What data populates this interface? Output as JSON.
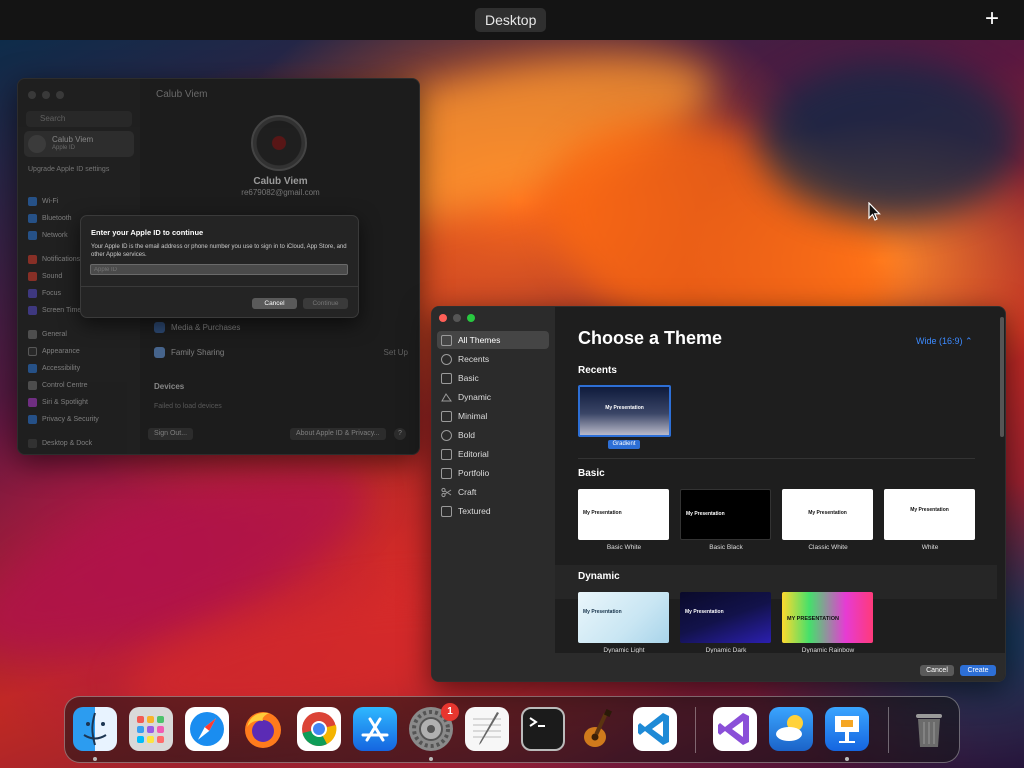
{
  "topbar": {
    "desktop_label": "Desktop",
    "add_label": "+"
  },
  "settings": {
    "window_title": "Calub Viem",
    "search_placeholder": "Search",
    "user": {
      "name": "Calub Viem",
      "subtitle": "Apple ID"
    },
    "promo": "Upgrade Apple ID settings",
    "sidebar_items": [
      "Wi-Fi",
      "Bluetooth",
      "Network",
      "Notifications",
      "Sound",
      "Focus",
      "Screen Time",
      "General",
      "Appearance",
      "Accessibility",
      "Control Centre",
      "Siri & Spotlight",
      "Privacy & Security",
      "Desktop & Dock"
    ],
    "account": {
      "name": "Calub Viem",
      "email": "re679082@gmail.com"
    },
    "rows": [
      {
        "label": "Media & Purchases",
        "right": ""
      },
      {
        "label": "Family Sharing",
        "right": "Set Up"
      }
    ],
    "devices_header": "Devices",
    "devices_note": "Failed to load devices",
    "sign_out": "Sign Out...",
    "about": "About Apple ID & Privacy...",
    "help": "?"
  },
  "dialog": {
    "title": "Enter your Apple ID to continue",
    "body": "Your Apple ID is the email address or phone number you use to sign in to iCloud, App Store, and other Apple services.",
    "input_placeholder": "Apple ID",
    "cancel": "Cancel",
    "continue": "Continue"
  },
  "keynote": {
    "sidebar": [
      {
        "label": "All Themes",
        "icon": "all-themes-icon",
        "selected": true
      },
      {
        "label": "Recents",
        "icon": "clock-icon"
      },
      {
        "label": "Basic",
        "icon": "basic-icon"
      },
      {
        "label": "Dynamic",
        "icon": "dynamic-icon"
      },
      {
        "label": "Minimal",
        "icon": "minimal-icon"
      },
      {
        "label": "Bold",
        "icon": "bold-icon"
      },
      {
        "label": "Editorial",
        "icon": "editorial-icon"
      },
      {
        "label": "Portfolio",
        "icon": "portfolio-icon"
      },
      {
        "label": "Craft",
        "icon": "scissors-icon"
      },
      {
        "label": "Textured",
        "icon": "textured-icon"
      }
    ],
    "title": "Choose a Theme",
    "aspect": "Wide (16:9) ⌃",
    "sections": {
      "recents": "Recents",
      "basic": "Basic",
      "dynamic": "Dynamic"
    },
    "recents_themes": [
      {
        "name": "Gradient",
        "thumb_title": "My Presentation"
      }
    ],
    "basic_themes": [
      {
        "name": "Basic White",
        "thumb_title": "My Presentation"
      },
      {
        "name": "Basic Black",
        "thumb_title": "My Presentation"
      },
      {
        "name": "Classic White",
        "thumb_title": "My Presentation"
      },
      {
        "name": "White",
        "thumb_title": "My Presentation"
      }
    ],
    "dynamic_themes": [
      {
        "name": "Dynamic Light",
        "thumb_title": "My Presentation"
      },
      {
        "name": "Dynamic Dark",
        "thumb_title": "My Presentation"
      },
      {
        "name": "Dynamic Rainbow",
        "thumb_title": "MY PRESENTATION"
      }
    ],
    "cancel": "Cancel",
    "create": "Create"
  },
  "dock": {
    "apps": [
      {
        "name": "Finder",
        "icon": "finder-icon",
        "running": true
      },
      {
        "name": "Launchpad",
        "icon": "launchpad-icon"
      },
      {
        "name": "Safari",
        "icon": "safari-icon"
      },
      {
        "name": "Firefox",
        "icon": "firefox-icon"
      },
      {
        "name": "Chrome",
        "icon": "chrome-icon"
      },
      {
        "name": "App Store",
        "icon": "app-store-icon"
      },
      {
        "name": "System Settings",
        "icon": "settings-icon",
        "running": true,
        "badge": "1"
      },
      {
        "name": "TextEdit",
        "icon": "textedit-icon"
      },
      {
        "name": "Terminal",
        "icon": "terminal-icon"
      },
      {
        "name": "GarageBand",
        "icon": "garageband-icon"
      },
      {
        "name": "Visual Studio Code",
        "icon": "vscode-icon"
      },
      {
        "name": "Visual Studio",
        "icon": "visual-studio-icon"
      },
      {
        "name": "Weather",
        "icon": "weather-icon"
      },
      {
        "name": "Keynote",
        "icon": "keynote-icon",
        "running": true
      },
      {
        "name": "Trash",
        "icon": "trash-icon"
      }
    ]
  },
  "colors": {
    "accent": "#2d6fd6",
    "link": "#3d8bff",
    "badge": "#e8362f"
  }
}
